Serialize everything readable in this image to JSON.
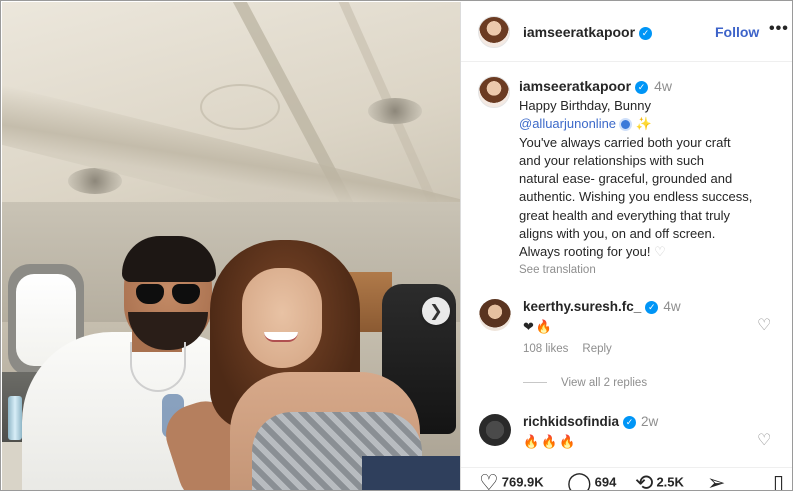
{
  "post": {
    "username": "iamseeratkapoor",
    "verified_mark": "✓",
    "follow_label": "Follow",
    "more_label": "•••",
    "next_label": "❯"
  },
  "caption": {
    "username": "iamseeratkapoor",
    "time": "4w",
    "line1": "Happy Birthday, Bunny",
    "mention": "@alluarjunonline",
    "body": "You've always carried both your craft\nand your relationships with such\nnatural ease- graceful, grounded and\nauthentic. Wishing you endless success,\ngreat health and everything that truly\naligns with you, on and off screen.\nAlways rooting for you!",
    "see_translation": "See translation"
  },
  "comments": [
    {
      "username": "keerthy.suresh.fc_",
      "time": "4w",
      "emojis": "❤🔥",
      "likes": "108 likes",
      "reply": "Reply",
      "view_replies": "View all 2 replies"
    },
    {
      "username": "richkidsofindia",
      "time": "2w",
      "emojis": "🔥🔥🔥"
    }
  ],
  "actions": {
    "likes": "769.9K",
    "comments": "694",
    "shares": "2.5K"
  },
  "icons": {
    "verified": "verified-badge-icon",
    "heart": "heart-icon",
    "comment": "comment-icon",
    "repost": "repost-icon",
    "share": "share-icon",
    "bookmark": "bookmark-icon",
    "next": "chevron-right-icon"
  },
  "colors": {
    "accent": "#0095f6",
    "follow": "#3d63c9",
    "mention": "#3d6ac9",
    "muted": "#8e8e8e"
  }
}
